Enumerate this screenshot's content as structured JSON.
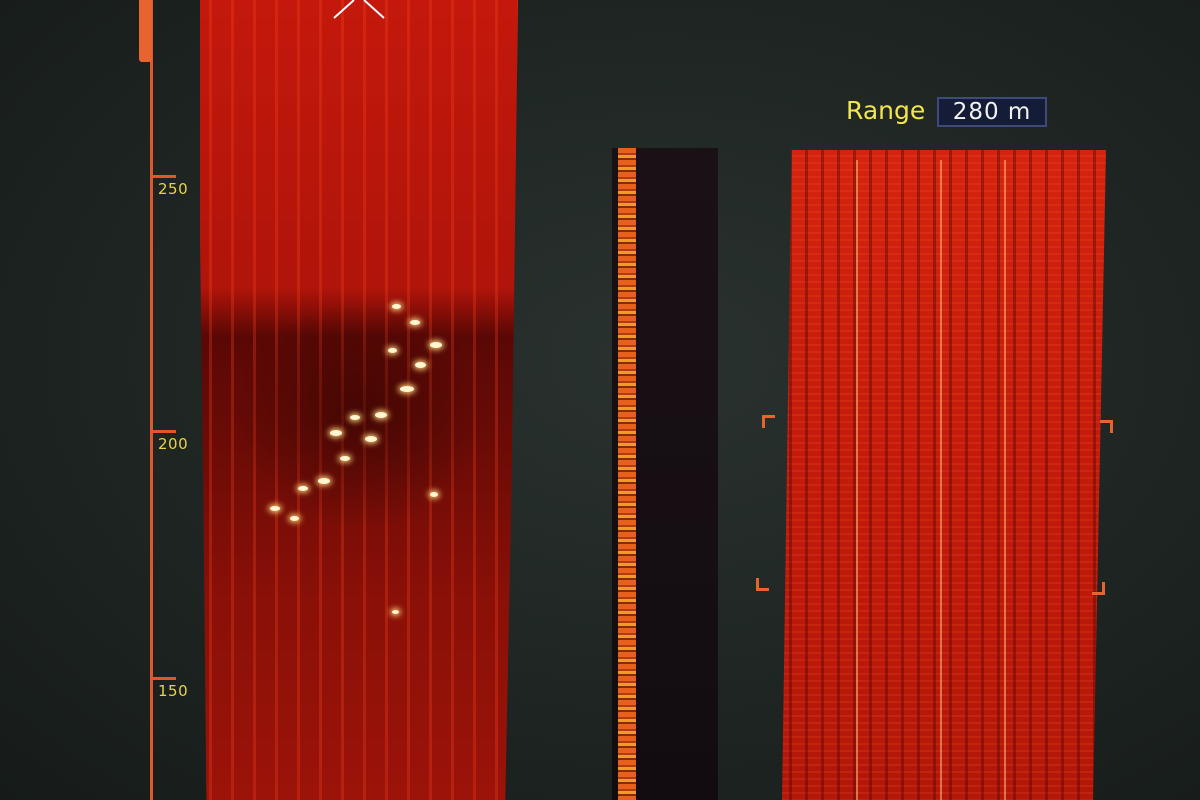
{
  "scale": {
    "ticks": [
      {
        "label": "250"
      },
      {
        "label": "200"
      },
      {
        "label": "150"
      }
    ]
  },
  "range": {
    "label": "Range",
    "value": "280",
    "unit": "m"
  },
  "colors": {
    "sonar_red": "#c4180c",
    "scale_orange": "#e0572c",
    "label_yellow": "#e9d24a",
    "range_box": "#141c38"
  }
}
